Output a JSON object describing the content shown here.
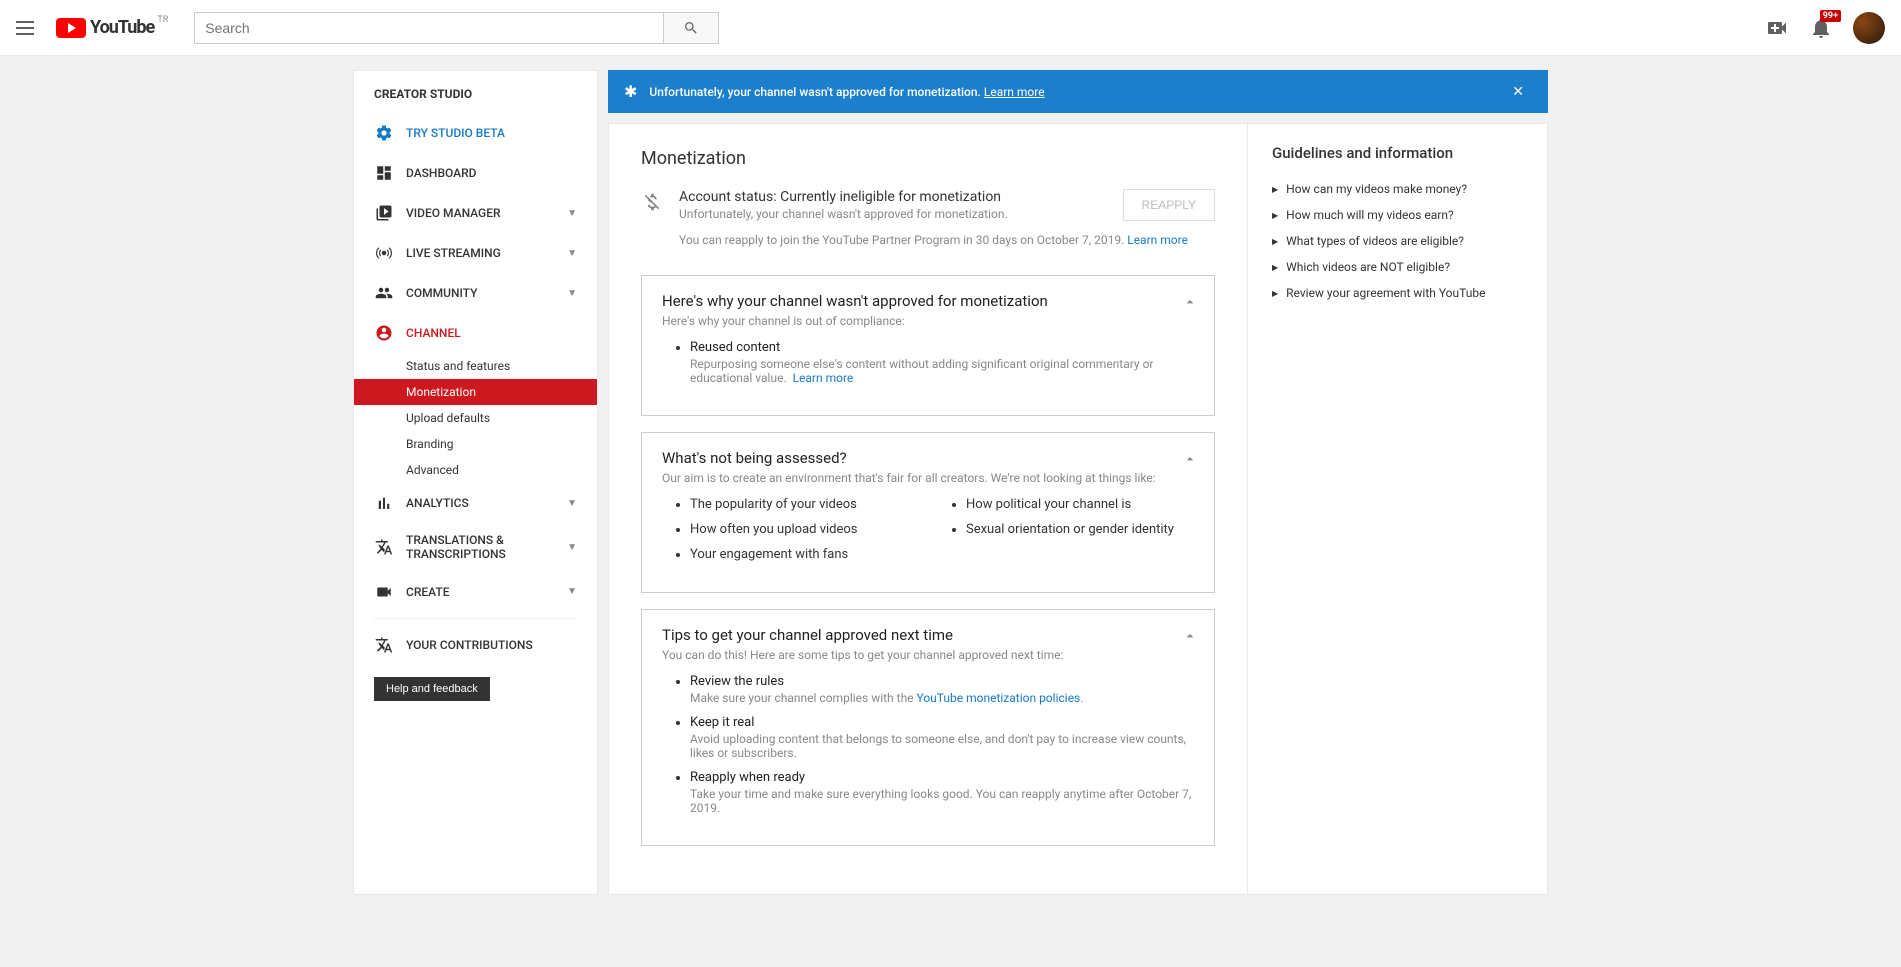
{
  "header": {
    "logo_text": "YouTube",
    "logo_sup": "TR",
    "search_placeholder": "Search",
    "notif_badge": "99+"
  },
  "sidebar": {
    "title": "CREATOR STUDIO",
    "beta": "TRY STUDIO BETA",
    "items": [
      {
        "label": "DASHBOARD"
      },
      {
        "label": "VIDEO MANAGER"
      },
      {
        "label": "LIVE STREAMING"
      },
      {
        "label": "COMMUNITY"
      },
      {
        "label": "CHANNEL"
      },
      {
        "label": "ANALYTICS"
      },
      {
        "label": "TRANSLATIONS & TRANSCRIPTIONS"
      },
      {
        "label": "CREATE"
      }
    ],
    "channel_subs": [
      "Status and features",
      "Monetization",
      "Upload defaults",
      "Branding",
      "Advanced"
    ],
    "contrib": "YOUR CONTRIBUTIONS",
    "help": "Help and feedback"
  },
  "alert": {
    "text": "Unfortunately, your channel wasn't approved for monetization.",
    "link": "Learn more"
  },
  "mon": {
    "h1": "Monetization",
    "status_title": "Account status: Currently ineligible for monetization",
    "status_sub": "Unfortunately, your channel wasn't approved for monetization.",
    "reapply": "REAPPLY",
    "reapply_note": "You can reapply to join the YouTube Partner Program in 30 days on October 7, 2019.",
    "learn_more": "Learn more"
  },
  "cards": {
    "c1": {
      "h": "Here's why your channel wasn't approved for monetization",
      "sub": "Here's why your channel is out of compliance:",
      "item_h": "Reused content",
      "item_sub": "Repurposing someone else's content without adding significant original commentary or educational value.",
      "learn": "Learn more"
    },
    "c2": {
      "h": "What's not being assessed?",
      "sub": "Our aim is to create an environment that's fair for all creators. We're not looking at things like:",
      "left": [
        "The popularity of your videos",
        "How often you upload videos",
        "Your engagement with fans"
      ],
      "right": [
        "How political your channel is",
        "Sexual orientation or gender identity"
      ]
    },
    "c3": {
      "h": "Tips to get your channel approved next time",
      "sub": "You can do this! Here are some tips to get your channel approved next time:",
      "items": [
        {
          "h": "Review the rules",
          "sub_a": "Make sure your channel complies with the ",
          "link": "YouTube monetization policies",
          "sub_b": "."
        },
        {
          "h": "Keep it real",
          "sub": "Avoid uploading content that belongs to someone else, and don't pay to increase view counts, likes or subscribers."
        },
        {
          "h": "Reapply when ready",
          "sub": "Take your time and make sure everything looks good. You can reapply anytime after October 7, 2019."
        }
      ]
    }
  },
  "side": {
    "h": "Guidelines and information",
    "links": [
      "How can my videos make money?",
      "How much will my videos earn?",
      "What types of videos are eligible?",
      "Which videos are NOT eligible?",
      "Review your agreement with YouTube"
    ]
  }
}
